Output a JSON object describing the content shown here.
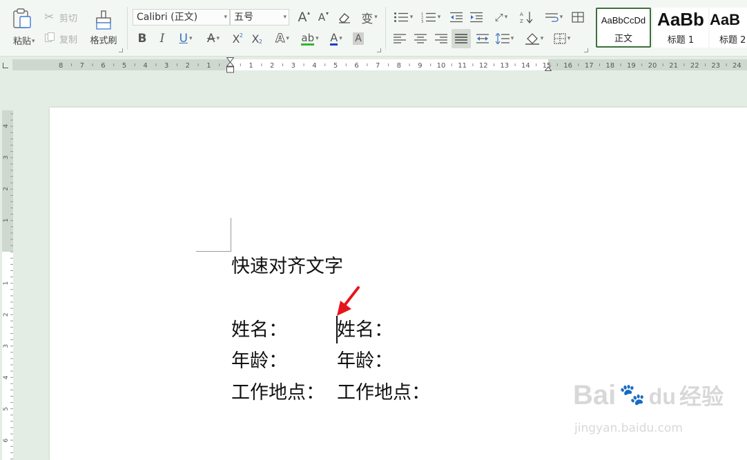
{
  "clipboard": {
    "paste_label": "粘贴",
    "cut_label": "剪切",
    "copy_label": "复制",
    "format_painter_label": "格式刷"
  },
  "font": {
    "family": "Calibri (正文)",
    "size": "五号"
  },
  "font_buttons": {
    "grow": "A",
    "shrink": "A",
    "bold": "B",
    "italic": "I",
    "underline": "U",
    "strike": "A",
    "superscript": "X",
    "subscript": "X",
    "text_effect": "A",
    "highlight": "ab",
    "font_color": "A",
    "char_shading": "A",
    "phonetic": "变"
  },
  "styles": [
    {
      "preview": "AaBbCcDd",
      "name": "正文"
    },
    {
      "preview": "AaBb",
      "name": "标题 1"
    },
    {
      "preview": "AaB",
      "name": "标题 2"
    }
  ],
  "ruler": {
    "left_numbers": [
      "8",
      "7",
      "6",
      "5",
      "4",
      "3",
      "2",
      "1"
    ],
    "right_numbers": [
      "1",
      "2",
      "3",
      "4",
      "5",
      "6",
      "7",
      "8",
      "9",
      "10",
      "11",
      "12",
      "13",
      "14",
      "15",
      "16",
      "17",
      "18",
      "19",
      "20",
      "21",
      "22",
      "23",
      "24"
    ],
    "vertical_numbers": [
      "4",
      "3",
      "2",
      "1",
      "1",
      "2",
      "3",
      "4",
      "5",
      "6"
    ]
  },
  "document": {
    "title": "快速对齐文字",
    "lines": [
      {
        "left": "姓名：",
        "right": "姓名："
      },
      {
        "left": "年龄：",
        "right": "年龄："
      },
      {
        "left": "工作地点：",
        "right": "工作地点："
      }
    ]
  },
  "watermark": {
    "brand": "Bai",
    "brand_suffix": "du",
    "product": "经验",
    "url": "jingyan.baidu.com"
  },
  "colors": {
    "ribbon_bg": "#f3f7f3",
    "canvas_bg": "#e4ede4",
    "highlight_green": "#2cb82c",
    "font_color_blue": "#1a3cd6",
    "arrow_red": "#e8141c"
  },
  "icons": [
    "paste-icon",
    "cut-icon",
    "copy-icon",
    "format-painter-icon",
    "eraser-icon",
    "bullets-icon",
    "numbering-icon",
    "outdent-icon",
    "indent-icon",
    "sort-icon",
    "align-left-icon",
    "align-center-icon",
    "align-right-icon",
    "justify-icon",
    "distribute-icon",
    "line-spacing-icon",
    "shading-icon",
    "borders-icon"
  ]
}
